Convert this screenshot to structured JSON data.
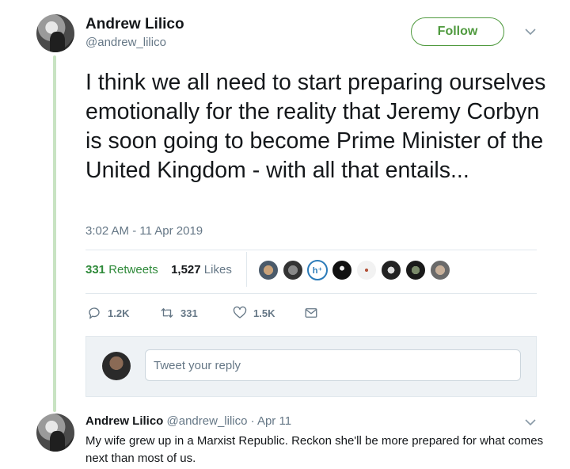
{
  "tweet": {
    "author_name": "Andrew Lilico",
    "author_handle": "@andrew_lilico",
    "follow_label": "Follow",
    "text": "I think we all need to start preparing ourselves emotionally for the reality that Jeremy Corbyn is soon going to become Prime Minister of the United Kingdom - with all that entails...",
    "timestamp": "3:02 AM - 11 Apr 2019",
    "retweets_count": "331",
    "retweets_label": "Retweets",
    "likes_count": "1,527",
    "likes_label": "Likes"
  },
  "actions": {
    "reply_count": "1.2K",
    "retweet_count": "331",
    "like_count": "1.5K"
  },
  "reply_box": {
    "placeholder": "Tweet your reply",
    "value": ""
  },
  "reply": {
    "author_name": "Andrew Lilico",
    "meta": "@andrew_lilico · Apr 11",
    "text": "My wife grew up in a Marxist Republic. Reckon she'll be more prepared for what comes next than most of us."
  },
  "icons": {
    "reply": "speech-bubble-icon",
    "retweet": "retweet-icon",
    "like": "heart-icon",
    "message": "envelope-icon",
    "caret": "chevron-down-icon"
  },
  "colors": {
    "accent": "#4f9a3e",
    "thread_line": "#c8e3c2",
    "secondary_text": "#657786"
  }
}
